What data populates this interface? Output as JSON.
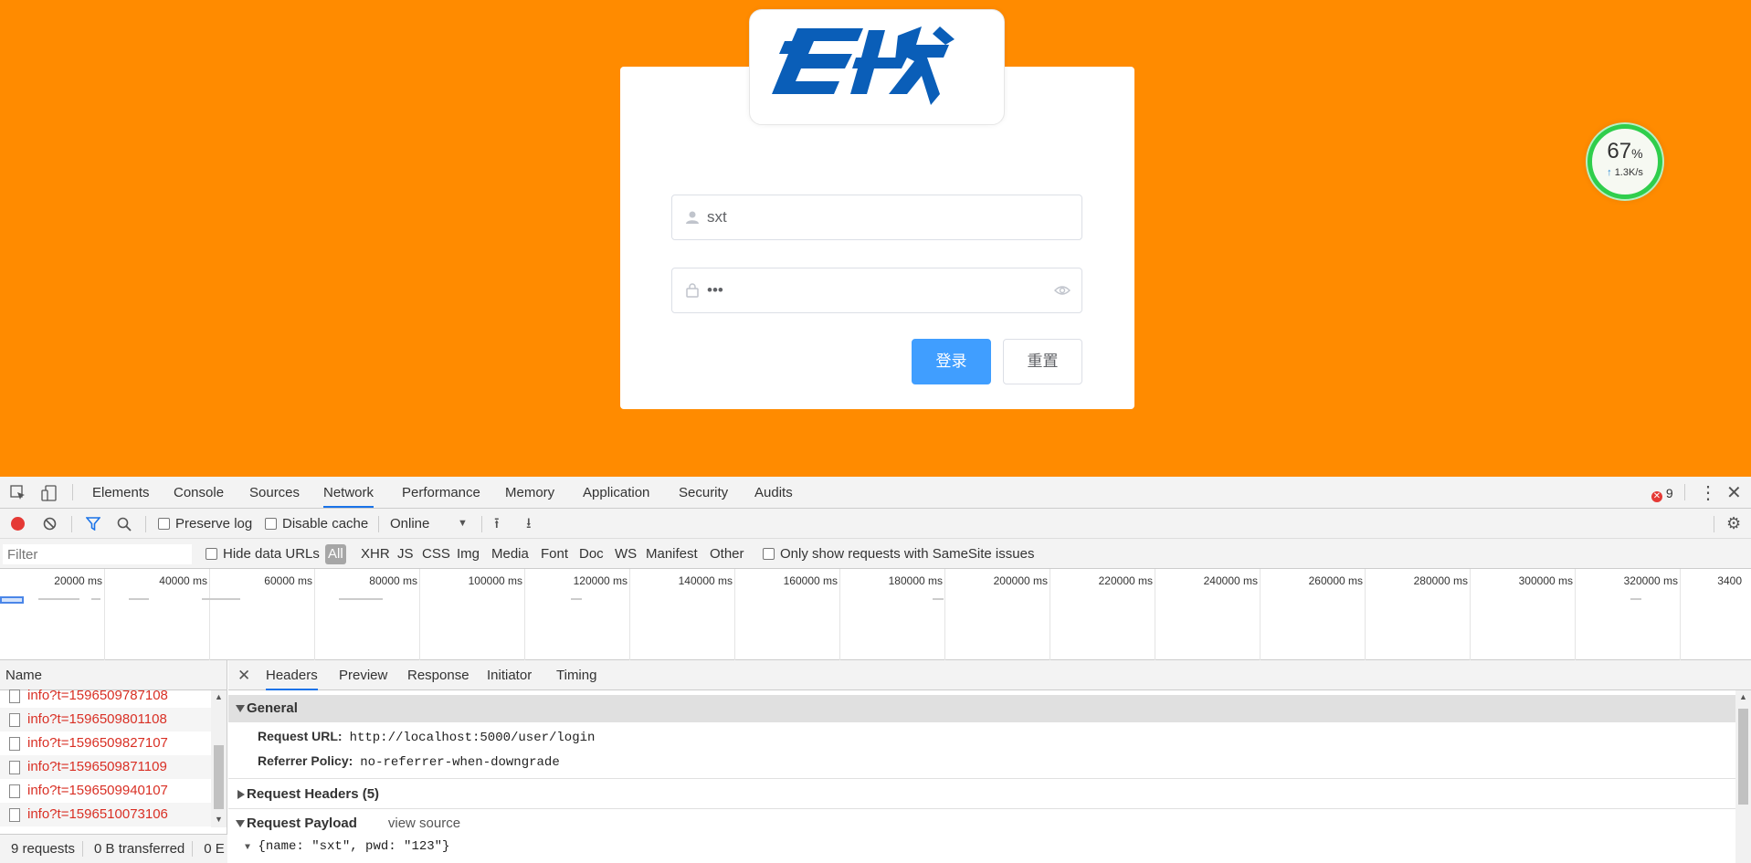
{
  "login": {
    "username_value": "sxt",
    "password_mask": "•••",
    "login_label": "登录",
    "reset_label": "重置",
    "colors": {
      "page_bg": "#ff8b00",
      "primary": "#409eff"
    }
  },
  "speed_widget": {
    "percent": "67",
    "percent_unit": "%",
    "rate": "1.3K/s"
  },
  "devtools": {
    "tabs": [
      "Elements",
      "Console",
      "Sources",
      "Network",
      "Performance",
      "Memory",
      "Application",
      "Security",
      "Audits"
    ],
    "active_tab": "Network",
    "error_count": "9",
    "toolbar": {
      "preserve_log": "Preserve log",
      "disable_cache": "Disable cache",
      "throttle": "Online"
    },
    "filter": {
      "placeholder": "Filter",
      "hide_data_urls": "Hide data URLs",
      "types": [
        "All",
        "XHR",
        "JS",
        "CSS",
        "Img",
        "Media",
        "Font",
        "Doc",
        "WS",
        "Manifest",
        "Other"
      ],
      "samesite": "Only show requests with SameSite issues"
    },
    "timeline_ticks": [
      "20000 ms",
      "40000 ms",
      "60000 ms",
      "80000 ms",
      "100000 ms",
      "120000 ms",
      "140000 ms",
      "160000 ms",
      "180000 ms",
      "200000 ms",
      "220000 ms",
      "240000 ms",
      "260000 ms",
      "280000 ms",
      "300000 ms",
      "320000 ms",
      "3400"
    ],
    "name_header": "Name",
    "requests": [
      "info?t=1596509787108",
      "info?t=1596509801108",
      "info?t=1596509827107",
      "info?t=1596509871109",
      "info?t=1596509940107",
      "info?t=1596510073106"
    ],
    "status": {
      "requests": "9 requests",
      "transferred": "0 B transferred",
      "resources": "0 E"
    },
    "detail_tabs": [
      "Headers",
      "Preview",
      "Response",
      "Initiator",
      "Timing"
    ],
    "active_detail_tab": "Headers",
    "general": {
      "title": "General",
      "request_url_label": "Request URL:",
      "request_url": "http://localhost:5000/user/login",
      "referrer_label": "Referrer Policy:",
      "referrer": "no-referrer-when-downgrade"
    },
    "request_headers": "Request Headers (5)",
    "payload": {
      "title": "Request Payload",
      "view_source": "view source",
      "body": "{name: \"sxt\", pwd: \"123\"}"
    }
  }
}
